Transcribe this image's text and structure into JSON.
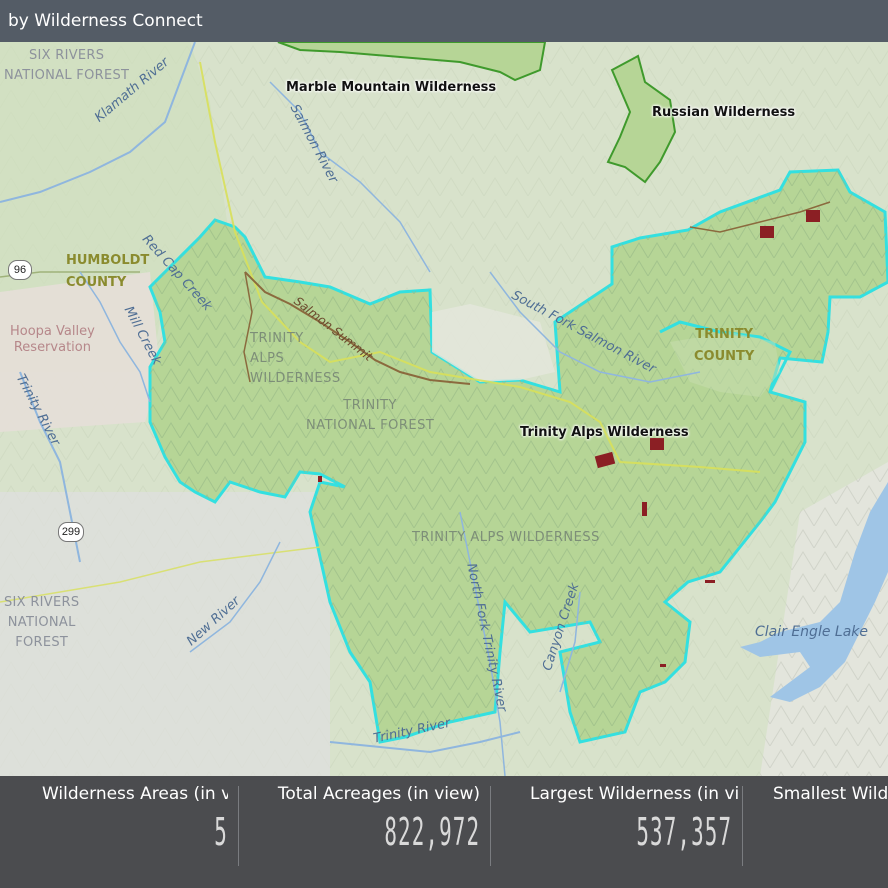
{
  "header": {
    "title": "by Wilderness Connect"
  },
  "map": {
    "wilderness_labels": {
      "marble": "Marble Mountain Wilderness",
      "russian": "Russian Wilderness",
      "trinity_alps": "Trinity Alps Wilderness"
    },
    "forests": {
      "six_rivers_top": [
        "SIX RIVERS",
        "NATIONAL FOREST"
      ],
      "trinity_alps_wilderness_map": [
        "TRINITY",
        "ALPS",
        "WILDERNESS"
      ],
      "trinity_nf": [
        "TRINITY",
        "NATIONAL FOREST"
      ],
      "trinity_alps_wilderness_lower": "TRINITY ALPS WILDERNESS",
      "six_rivers_bottom": [
        "SIX RIVERS",
        "NATIONAL",
        "FOREST"
      ]
    },
    "counties": {
      "humboldt": [
        "HUMBOLDT",
        "COUNTY"
      ],
      "trinity": [
        "TRINITY",
        "COUNTY"
      ]
    },
    "reservation": [
      "Hoopa Valley",
      "Reservation"
    ],
    "rivers": {
      "klamath": "Klamath River",
      "salmon": "Salmon River",
      "red_cap": "Red Cap Creek",
      "mill": "Mill Creek",
      "trinity_left": "Trinity River",
      "south_fork_salmon": "South Fork Salmon River",
      "new_river": "New River",
      "north_fork_trinity": "North Fork Trinity River",
      "canyon_creek": "Canyon Creek",
      "trinity_bottom": "Trinity River"
    },
    "summit": "Salmon Summit",
    "lake": "Clair Engle Lake",
    "highways": {
      "hwy96": "96",
      "hwy299": "299"
    },
    "colors": {
      "boundary": "#33e0e0",
      "wilderness_fill": "#b6d596",
      "private_inholding": "#8b1f24",
      "water": "#9fc5e6",
      "forest_land": "#c7ddb0"
    }
  },
  "stats": [
    {
      "label": "Wilderness Areas (in view)",
      "value": "5"
    },
    {
      "label": "Total Acreages (in view)",
      "value": "822,972"
    },
    {
      "label": "Largest Wilderness (in view)",
      "value": "537,357"
    },
    {
      "label": "Smallest Wilderness (in view)",
      "value": ""
    }
  ]
}
